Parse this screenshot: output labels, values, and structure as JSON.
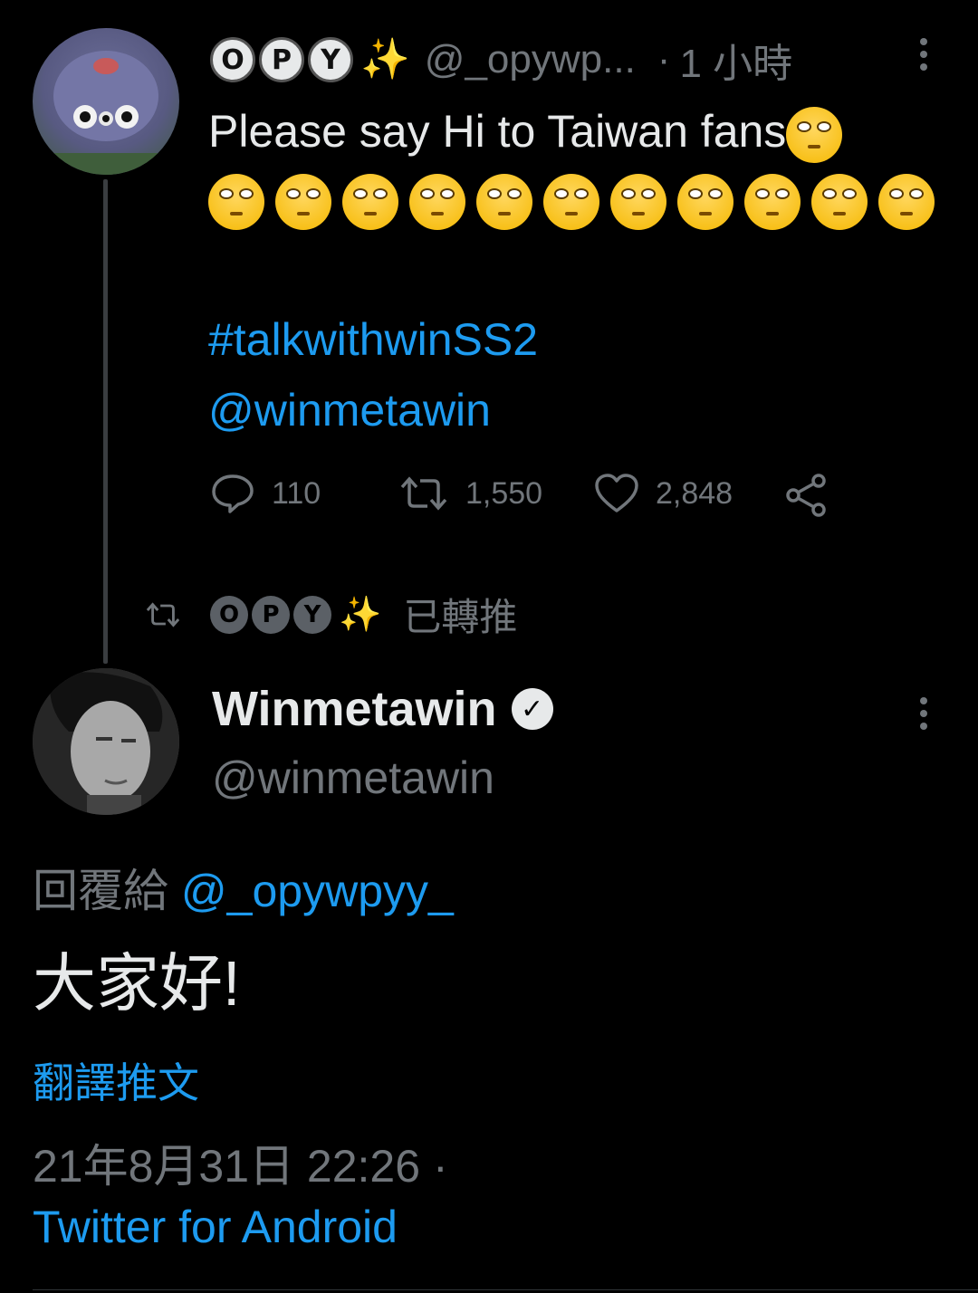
{
  "tweet1": {
    "letters": [
      "O",
      "P",
      "Y"
    ],
    "handle": "@_opywp...",
    "separator": "·",
    "time": "1 小時",
    "text": "Please say Hi to Taiwan fans",
    "hashtag": "#talkwithwinSS2",
    "mention": "@winmetawin",
    "replies": "110",
    "retweets": "1,550",
    "likes": "2,848"
  },
  "retweet_context": {
    "letters": [
      "O",
      "P",
      "Y"
    ],
    "label": "已轉推"
  },
  "tweet2": {
    "name": "Winmetawin",
    "handle": "@winmetawin",
    "reply_prefix": "回覆給",
    "reply_to": "@_opywpyy_",
    "text": "大家好!",
    "translate": "翻譯推文",
    "datetime": "21年8月31日 22:26",
    "separator": "·",
    "source": "Twitter for Android"
  },
  "icons": {
    "reply": "speech-bubble-icon",
    "retweet": "retweet-icon",
    "like": "heart-icon",
    "share": "share-icon",
    "more": "more-vertical-icon",
    "verified": "verified-badge-icon",
    "emoji": "face-with-rolling-eyes"
  },
  "colors": {
    "background": "#000000",
    "text": "#e7e9ea",
    "secondary": "#71767b",
    "link": "#1d9bf0"
  }
}
